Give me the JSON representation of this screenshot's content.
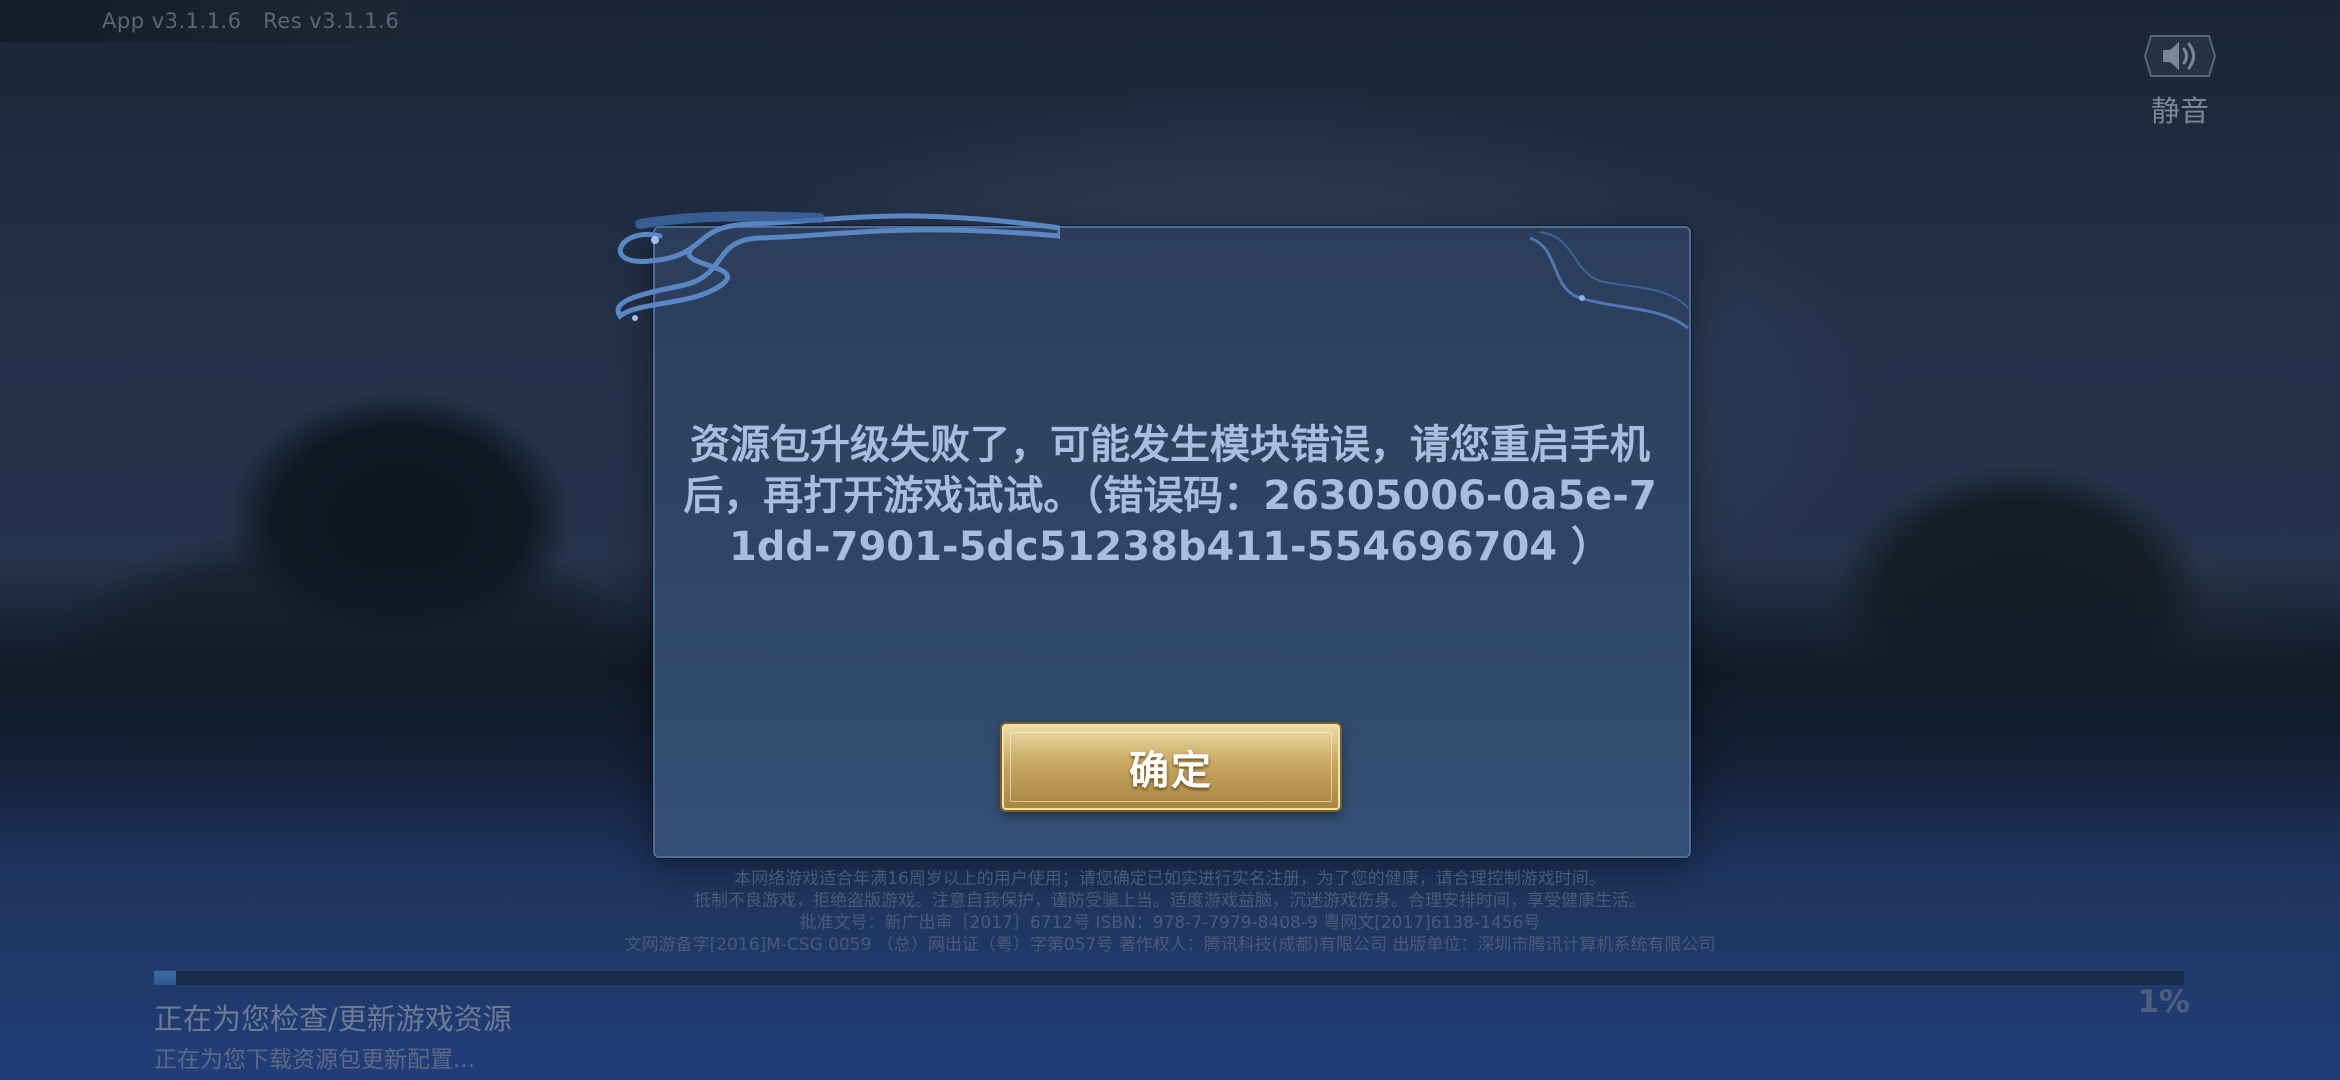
{
  "header": {
    "version_text": "App v3.1.1.6   Res v3.1.1.6",
    "mute": {
      "label": "静音",
      "icon": "speaker-icon"
    }
  },
  "dialog": {
    "message": "资源包升级失败了，可能发生模块错误，请您重启手机后，再打开游戏试试。（错误码：26305006-0a5e-71dd-7901-5dc51238b411-554696704 ）",
    "confirm_label": "确定"
  },
  "notice": {
    "lines": [
      "本网络游戏适合年满16周岁以上的用户使用；请您确定已如实进行实名注册，为了您的健康，请合理控制游戏时间。",
      "抵制不良游戏，拒绝盗版游戏。注意自我保护，谨防受骗上当。适度游戏益脑，沉迷游戏伤身。合理安排时间，享受健康生活。",
      "批准文号：新广出审［2017］6712号 ISBN：978-7-7979-8408-9 粤网文[2017]6138-1456号",
      "文网游备字[2016]M-CSG 0059 （总）网出证（粤）字第057号 著作权人：腾讯科技(成都)有限公司 出版单位：深圳市腾讯计算机系统有限公司"
    ]
  },
  "progress": {
    "status_main": "正在为您检查/更新游戏资源",
    "status_sub": "正在为您下载资源包更新配置...",
    "percent_text": "1%",
    "value": 0.01
  },
  "colors": {
    "dialog_text": "#a9bde0",
    "button_gold": "#c9a863",
    "progress_fill": "#3e6ea8"
  }
}
